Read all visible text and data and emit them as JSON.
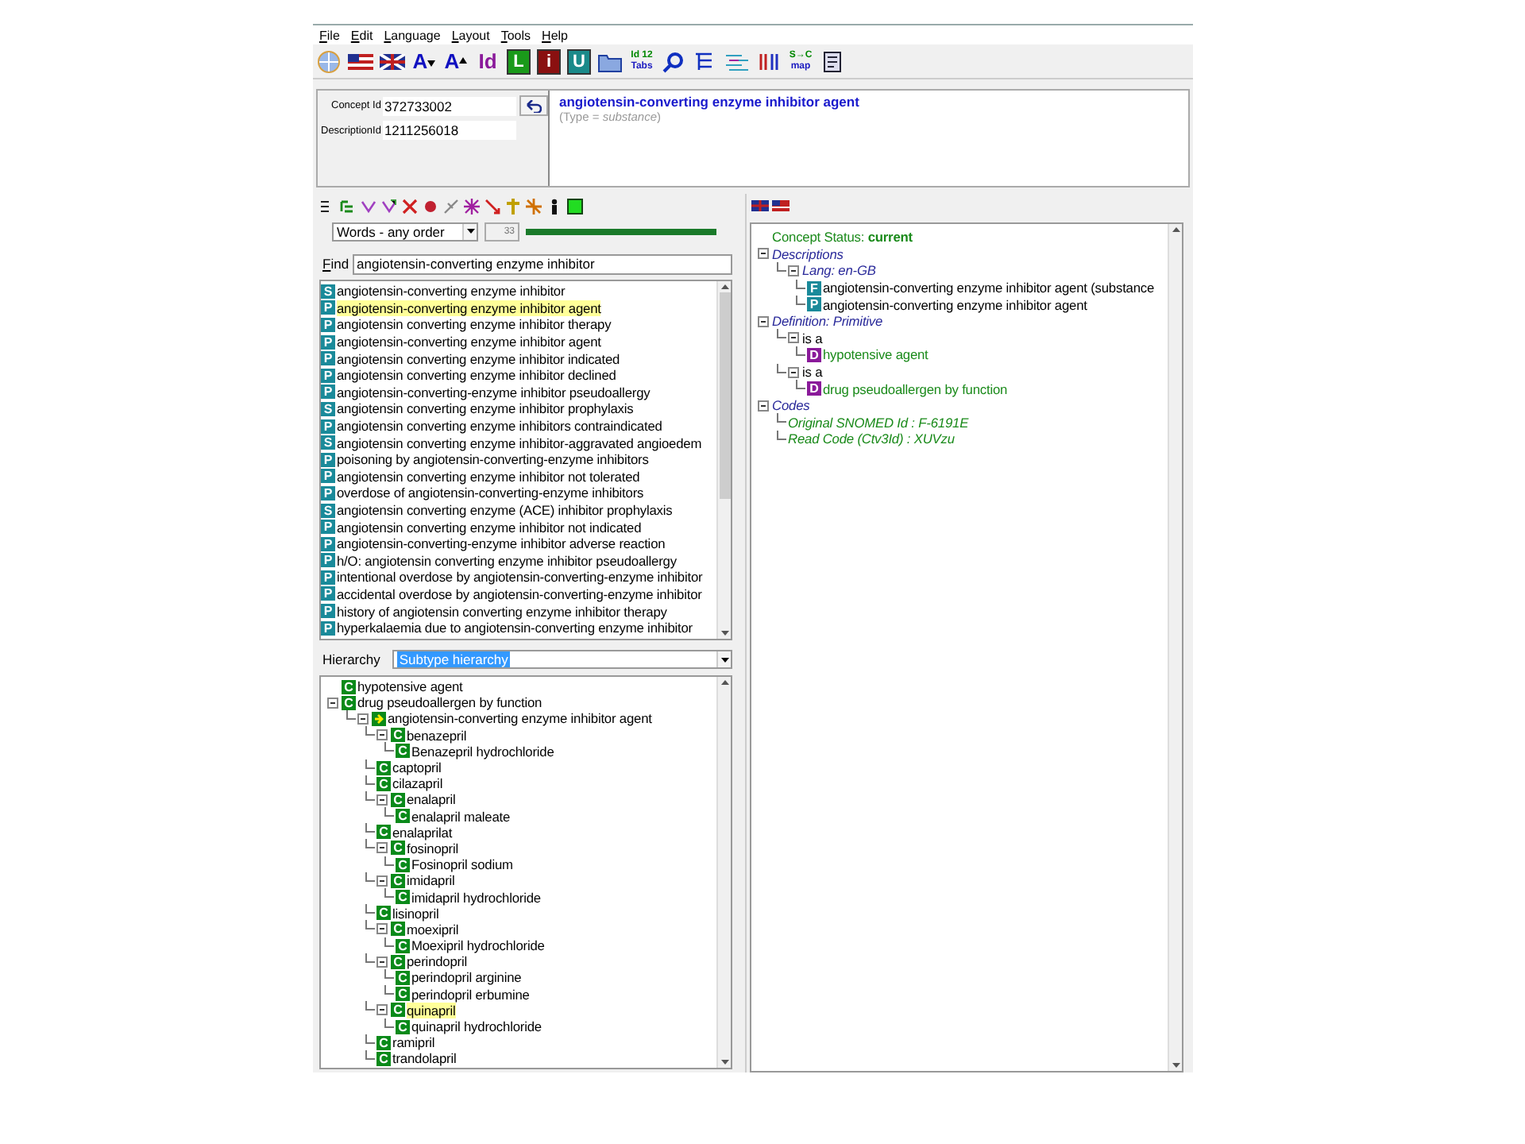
{
  "menu": [
    "File",
    "Edit",
    "Language",
    "Layout",
    "Tools",
    "Help"
  ],
  "toolbar": [
    {
      "kind": "globe"
    },
    {
      "kind": "flag-us"
    },
    {
      "kind": "flag-uk"
    },
    {
      "kind": "font-smaller",
      "label": "A",
      "color": "#1010c0"
    },
    {
      "kind": "font-larger",
      "label": "A",
      "color": "#1010c0"
    },
    {
      "kind": "glyph",
      "label": "Id",
      "color": "#8a1a9a"
    },
    {
      "kind": "tile",
      "label": "L",
      "color": "#1a9a1a"
    },
    {
      "kind": "tile",
      "label": "i",
      "color": "#8a1010"
    },
    {
      "kind": "tile",
      "label": "U",
      "color": "#1a8a8a"
    },
    {
      "kind": "folder"
    },
    {
      "kind": "stack",
      "lines": [
        "Id 12",
        "Tabs"
      ]
    },
    {
      "kind": "search"
    },
    {
      "kind": "tree"
    },
    {
      "kind": "lines"
    },
    {
      "kind": "split"
    },
    {
      "kind": "stack",
      "lines": [
        "S→C",
        "map"
      ]
    },
    {
      "kind": "script"
    }
  ],
  "concept": {
    "concept_id_label": "Concept Id",
    "concept_id": "372733002",
    "description_id_label": "DescriptionId",
    "description_id": "1211256018",
    "title": "angiotensin-converting enzyme inhibitor agent",
    "type_line": "(Type = *substance*)"
  },
  "search_toolbar": [
    {
      "kind": "list"
    },
    {
      "kind": "outline"
    },
    {
      "kind": "filter"
    },
    {
      "kind": "filter-add"
    },
    {
      "kind": "delete"
    },
    {
      "kind": "record"
    },
    {
      "kind": "sprig"
    },
    {
      "kind": "burst"
    },
    {
      "kind": "arrow"
    },
    {
      "kind": "plus"
    },
    {
      "kind": "spark"
    },
    {
      "kind": "figure"
    },
    {
      "kind": "square"
    }
  ],
  "search": {
    "mode": "Words - any order",
    "count": "33",
    "level": 1,
    "find_label": "Find",
    "find_value": "angiotensin-converting enzyme inhibitor"
  },
  "results": [
    {
      "badge": "S",
      "text": "angiotensin-converting enzyme inhibitor",
      "selected": false
    },
    {
      "badge": "P",
      "text": "angiotensin-converting enzyme inhibitor agent",
      "selected": true
    },
    {
      "badge": "P",
      "text": "angiotensin converting enzyme inhibitor therapy",
      "selected": false
    },
    {
      "badge": "P",
      "text": "angiotensin-converting enzyme inhibitor agent",
      "selected": false
    },
    {
      "badge": "P",
      "text": "angiotensin converting enzyme inhibitor indicated",
      "selected": false
    },
    {
      "badge": "P",
      "text": "angiotensin converting enzyme inhibitor declined",
      "selected": false
    },
    {
      "badge": "P",
      "text": "angiotensin-converting-enzyme inhibitor pseudoallergy",
      "selected": false
    },
    {
      "badge": "S",
      "text": "angiotensin converting enzyme inhibitor prophylaxis",
      "selected": false
    },
    {
      "badge": "P",
      "text": "angiotensin converting enzyme inhibitors contraindicated",
      "selected": false
    },
    {
      "badge": "S",
      "text": "angiotensin converting enzyme inhibitor-aggravated angioedem",
      "selected": false
    },
    {
      "badge": "P",
      "text": "poisoning by angiotensin-converting-enzyme inhibitors",
      "selected": false
    },
    {
      "badge": "P",
      "text": "angiotensin converting enzyme inhibitor not tolerated",
      "selected": false
    },
    {
      "badge": "P",
      "text": "overdose of angiotensin-converting-enzyme inhibitors",
      "selected": false
    },
    {
      "badge": "S",
      "text": "angiotensin converting enzyme (ACE) inhibitor prophylaxis",
      "selected": false
    },
    {
      "badge": "P",
      "text": "angiotensin converting enzyme inhibitor not indicated",
      "selected": false
    },
    {
      "badge": "P",
      "text": "angiotensin-converting-enzyme inhibitor adverse reaction",
      "selected": false
    },
    {
      "badge": "P",
      "text": "h/O: angiotensin converting enzyme inhibitor pseudoallergy",
      "selected": false
    },
    {
      "badge": "P",
      "text": "intentional overdose by angiotensin-converting-enzyme inhibitor",
      "selected": false
    },
    {
      "badge": "P",
      "text": "accidental overdose by angiotensin-converting-enzyme inhibitor",
      "selected": false
    },
    {
      "badge": "P",
      "text": "history of angiotensin converting enzyme inhibitor therapy",
      "selected": false
    },
    {
      "badge": "P",
      "text": "hyperkalaemia due to angiotensin-converting enzyme inhibitor",
      "selected": false
    }
  ],
  "hierarchy": {
    "label": "Hierarchy",
    "value": "Subtype hierarchy",
    "tree": [
      {
        "kind": "concept",
        "badge": "C",
        "text": "hypotensive agent",
        "selected": false
      },
      {
        "kind": "concept",
        "badge": "C",
        "text": "drug pseudoallergen by function",
        "expanded": true,
        "selected": false,
        "children": [
          {
            "kind": "current",
            "text": "angiotensin-converting enzyme inhibitor agent",
            "expanded": true,
            "selected": false,
            "children": [
              {
                "kind": "concept",
                "badge": "C",
                "text": "benazepril",
                "expanded": true,
                "selected": false,
                "children": [
                  {
                    "kind": "concept",
                    "badge": "C",
                    "text": "Benazepril hydrochloride",
                    "selected": false
                  }
                ]
              },
              {
                "kind": "concept",
                "badge": "C",
                "text": "captopril",
                "selected": false
              },
              {
                "kind": "concept",
                "badge": "C",
                "text": "cilazapril",
                "selected": false
              },
              {
                "kind": "concept",
                "badge": "C",
                "text": "enalapril",
                "expanded": true,
                "selected": false,
                "children": [
                  {
                    "kind": "concept",
                    "badge": "C",
                    "text": "enalapril maleate",
                    "selected": false
                  }
                ]
              },
              {
                "kind": "concept",
                "badge": "C",
                "text": "enalaprilat",
                "selected": false
              },
              {
                "kind": "concept",
                "badge": "C",
                "text": "fosinopril",
                "expanded": true,
                "selected": false,
                "children": [
                  {
                    "kind": "concept",
                    "badge": "C",
                    "text": "Fosinopril sodium",
                    "selected": false
                  }
                ]
              },
              {
                "kind": "concept",
                "badge": "C",
                "text": "imidapril",
                "expanded": true,
                "selected": false,
                "children": [
                  {
                    "kind": "concept",
                    "badge": "C",
                    "text": "imidapril hydrochloride",
                    "selected": false
                  }
                ]
              },
              {
                "kind": "concept",
                "badge": "C",
                "text": "lisinopril",
                "selected": false
              },
              {
                "kind": "concept",
                "badge": "C",
                "text": "moexipril",
                "expanded": true,
                "selected": false,
                "children": [
                  {
                    "kind": "concept",
                    "badge": "C",
                    "text": "Moexipril hydrochloride",
                    "selected": false
                  }
                ]
              },
              {
                "kind": "concept",
                "badge": "C",
                "text": "perindopril",
                "expanded": true,
                "selected": false,
                "children": [
                  {
                    "kind": "concept",
                    "badge": "C",
                    "text": "perindopril arginine",
                    "selected": false
                  },
                  {
                    "kind": "concept",
                    "badge": "C",
                    "text": "perindopril erbumine",
                    "selected": false
                  }
                ]
              },
              {
                "kind": "concept",
                "badge": "C",
                "text": "quinapril",
                "expanded": true,
                "selected": true,
                "children": [
                  {
                    "kind": "concept",
                    "badge": "C",
                    "text": "quinapril hydrochloride",
                    "selected": false
                  }
                ]
              },
              {
                "kind": "concept",
                "badge": "C",
                "text": "ramipril",
                "selected": false
              },
              {
                "kind": "concept",
                "badge": "C",
                "text": "trandolapril",
                "selected": false
              }
            ]
          }
        ]
      }
    ]
  },
  "details": {
    "languages": [
      {
        "kind": "flag-uk"
      },
      {
        "kind": "flag-us"
      }
    ],
    "tree": [
      {
        "kind": "status",
        "text": "Concept Status: **current**"
      },
      {
        "kind": "section",
        "text": "Descriptions",
        "expanded": true,
        "children": [
          {
            "kind": "section",
            "text": "Lang: en-GB",
            "expanded": true,
            "children": [
              {
                "kind": "description",
                "badge": "F",
                "text": "angiotensin-converting enzyme inhibitor agent (substance"
              },
              {
                "kind": "description",
                "badge": "P",
                "text": "angiotensin-converting enzyme inhibitor agent"
              }
            ]
          }
        ]
      },
      {
        "kind": "section",
        "text": "Definition: Primitive",
        "expanded": true,
        "children": [
          {
            "kind": "relation",
            "text": "is a",
            "expanded": true,
            "children": [
              {
                "kind": "target",
                "badge": "D",
                "text": "hypotensive agent"
              }
            ]
          },
          {
            "kind": "relation",
            "text": "is a",
            "expanded": true,
            "children": [
              {
                "kind": "target",
                "badge": "D",
                "text": "drug pseudoallergen by function"
              }
            ]
          }
        ]
      },
      {
        "kind": "section",
        "text": "Codes",
        "expanded": true,
        "children": [
          {
            "kind": "code",
            "text": "Original SNOMED Id : F-6191E"
          },
          {
            "kind": "code",
            "text": "Read Code (Ctv3Id) : XUVzu"
          }
        ]
      }
    ]
  }
}
